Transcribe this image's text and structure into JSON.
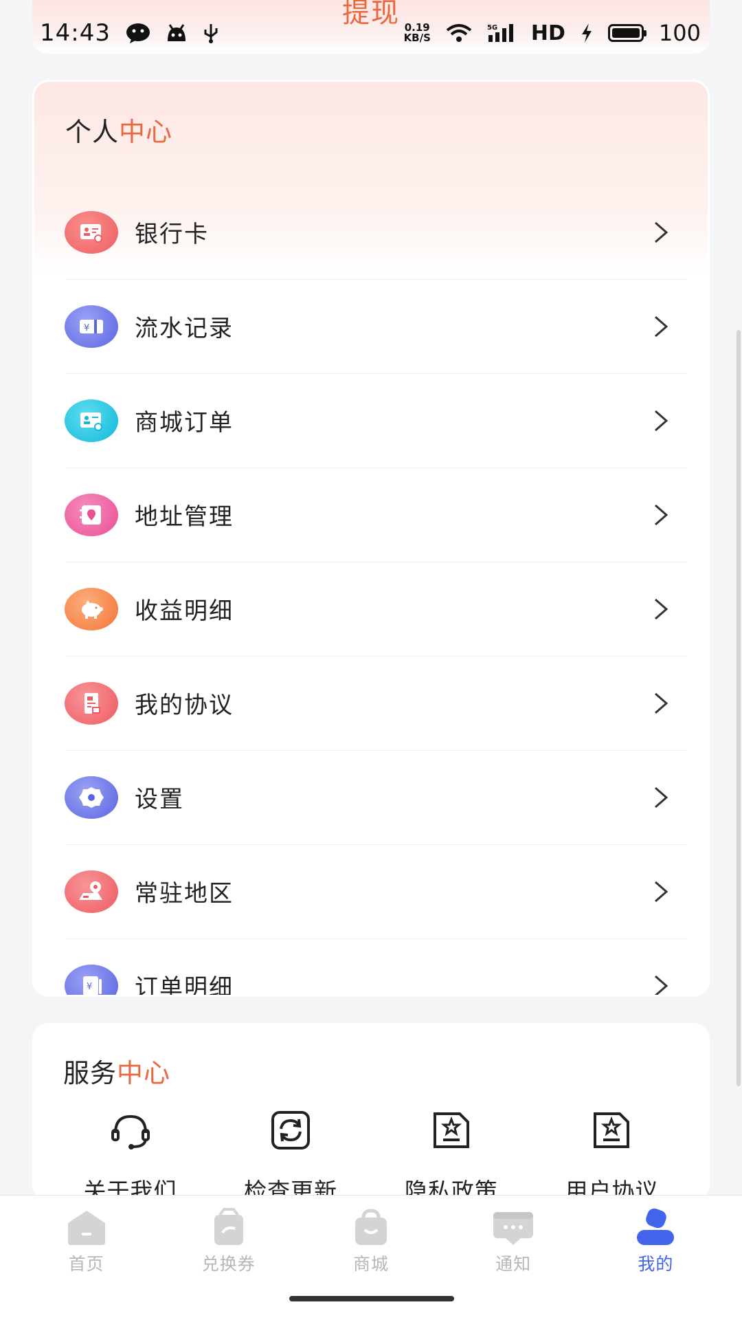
{
  "header": {
    "title": "提现"
  },
  "status_bar": {
    "time": "14:43",
    "net_speed_top": "0.19",
    "net_speed_bottom": "KB/S",
    "signal": "5G",
    "hd": "HD",
    "battery": "100",
    "icons": [
      "wechat-icon",
      "android-icon",
      "usb-icon",
      "wifi-icon",
      "signal-icon",
      "charging-icon",
      "battery-icon"
    ]
  },
  "personal_center": {
    "title_main": "个人",
    "title_accent": "中心",
    "items": [
      {
        "label": "银行卡",
        "icon": "bank-card-icon",
        "color": "#f26d6d"
      },
      {
        "label": "流水记录",
        "icon": "statement-icon",
        "color": "#6e78ea"
      },
      {
        "label": "商城订单",
        "icon": "shop-order-icon",
        "color": "#18c4e0"
      },
      {
        "label": "地址管理",
        "icon": "address-icon",
        "color": "#f064a0"
      },
      {
        "label": "收益明细",
        "icon": "piggy-bank-icon",
        "color": "#f7844f"
      },
      {
        "label": "我的协议",
        "icon": "agreement-icon",
        "color": "#f0666c"
      },
      {
        "label": "设置",
        "icon": "settings-icon",
        "color": "#6e78ea"
      },
      {
        "label": "常驻地区",
        "icon": "region-icon",
        "color": "#f0666c"
      },
      {
        "label": "订单明细",
        "icon": "order-detail-icon",
        "color": "#6e78ea"
      }
    ]
  },
  "service_center": {
    "title_main": "服务",
    "title_accent": "中心",
    "items": [
      {
        "label": "关于我们",
        "icon": "headset-icon"
      },
      {
        "label": "检查更新",
        "icon": "refresh-icon"
      },
      {
        "label": "隐私政策",
        "icon": "privacy-doc-icon"
      },
      {
        "label": "用户协议",
        "icon": "user-agreement-icon"
      }
    ]
  },
  "bottom_nav": {
    "items": [
      {
        "label": "首页",
        "icon": "home-icon",
        "active": false
      },
      {
        "label": "兑换券",
        "icon": "coupon-icon",
        "active": false
      },
      {
        "label": "商城",
        "icon": "shop-bag-icon",
        "active": false
      },
      {
        "label": "通知",
        "icon": "message-icon",
        "active": false
      },
      {
        "label": "我的",
        "icon": "profile-icon",
        "active": true
      }
    ],
    "active_color": "#4263eb",
    "inactive_color": "#c8c8c8"
  },
  "colors": {
    "accent": "#e8693f",
    "background": "#f4f5f7"
  }
}
